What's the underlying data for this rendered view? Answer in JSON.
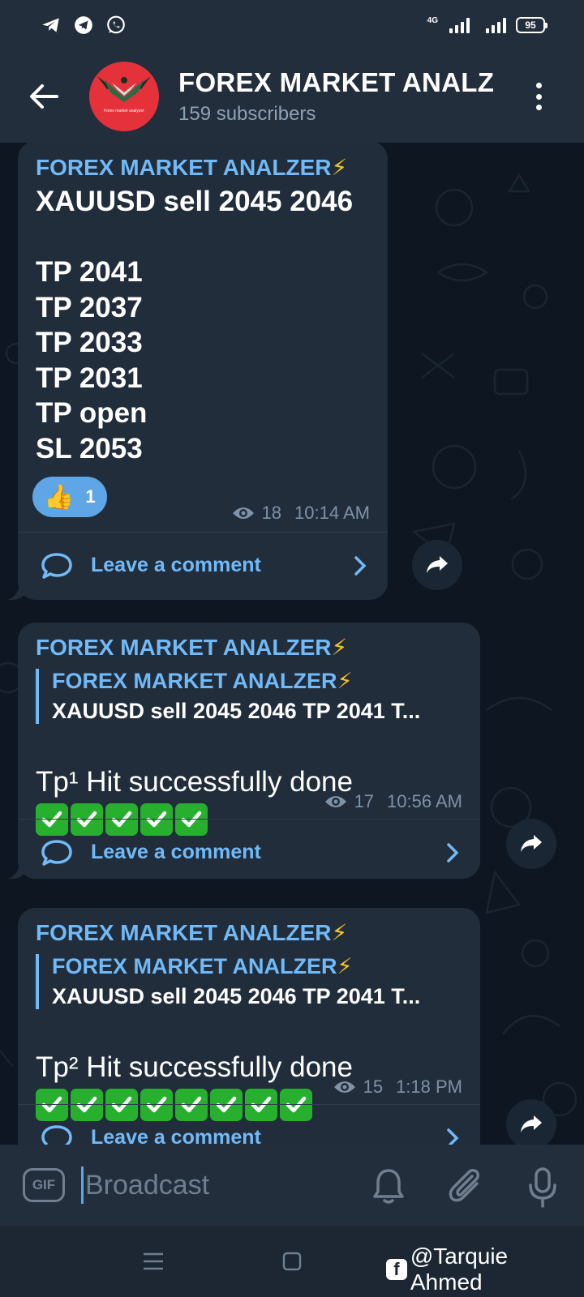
{
  "status_bar": {
    "network_label": "4G",
    "battery": "95"
  },
  "header": {
    "title": "FOREX MARKET ANALZER",
    "subtitle": "159 subscribers",
    "avatar_text": "Forex market analyzer"
  },
  "messages": [
    {
      "author": "FOREX MARKET ANALZER",
      "lines": "XAUUSD sell 2045 2046\n\nTP 2041\nTP 2037\nTP 2033\nTP 2031\nTP open\nSL 2053",
      "reaction": {
        "emoji": "👍",
        "count": "1"
      },
      "views": "18",
      "time": "10:14 AM",
      "comment_label": "Leave a comment"
    },
    {
      "author": "FOREX MARKET ANALZER",
      "reply_author": "FOREX MARKET ANALZER",
      "reply_text": "XAUUSD sell 2045 2046  TP 2041 T...",
      "text": "Tp¹ Hit successfully done",
      "check_count": 5,
      "views": "17",
      "time": "10:56 AM",
      "comment_label": "Leave a comment"
    },
    {
      "author": "FOREX MARKET ANALZER",
      "reply_author": "FOREX MARKET ANALZER",
      "reply_text": "XAUUSD sell 2045 2046  TP 2041 T...",
      "text": "Tp² Hit successfully done",
      "check_count": 8,
      "views": "15",
      "time": "1:18 PM",
      "comment_label": "Leave a comment"
    }
  ],
  "input": {
    "gif_label": "GIF",
    "placeholder": "Broadcast"
  },
  "watermark": "@Tarquie Ahmed",
  "colors": {
    "accent": "#71baf7",
    "bubble": "#212d3b",
    "header": "#232e3c",
    "chat_bg": "#0e1621",
    "check_green": "#27b02e"
  }
}
